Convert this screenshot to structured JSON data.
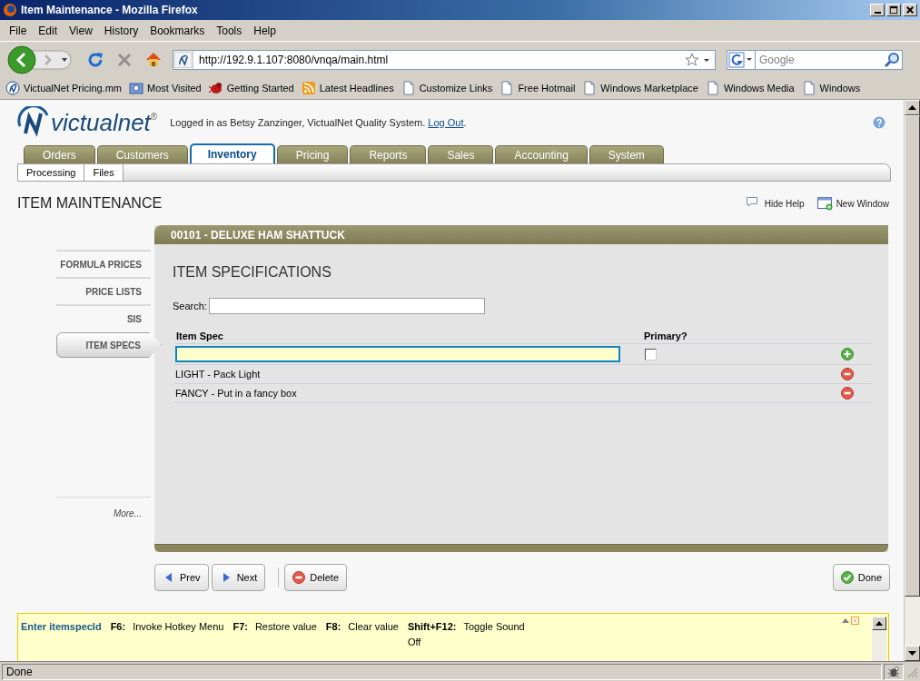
{
  "window": {
    "title": "Item Maintenance - Mozilla Firefox"
  },
  "menu": [
    "File",
    "Edit",
    "View",
    "History",
    "Bookmarks",
    "Tools",
    "Help"
  ],
  "address": {
    "value": "http://192.9.1.107:8080/vnqa/main.html"
  },
  "web_search": {
    "placeholder": "Google"
  },
  "bookmarks": [
    {
      "label": "VictualNet Pricing.mm",
      "kind": "site"
    },
    {
      "label": "Most Visited",
      "kind": "folder"
    },
    {
      "label": "Getting Started",
      "kind": "bug"
    },
    {
      "label": "Latest Headlines",
      "kind": "feed"
    },
    {
      "label": "Customize Links",
      "kind": "page"
    },
    {
      "label": "Free Hotmail",
      "kind": "page"
    },
    {
      "label": "Windows Marketplace",
      "kind": "page"
    },
    {
      "label": "Windows Media",
      "kind": "page"
    },
    {
      "label": "Windows",
      "kind": "page"
    }
  ],
  "header": {
    "logo": "victualnet",
    "logo_mark": "®",
    "login_text": "Logged in as Betsy Zanzinger, VictualNet Quality System.",
    "logout_link": "Log Out",
    "login_end": "."
  },
  "tabs": [
    {
      "label": "Orders",
      "selected": false
    },
    {
      "label": "Customers",
      "selected": false
    },
    {
      "label": "Inventory",
      "selected": true
    },
    {
      "label": "Pricing",
      "selected": false
    },
    {
      "label": "Reports",
      "selected": false
    },
    {
      "label": "Sales",
      "selected": false
    },
    {
      "label": "Accounting",
      "selected": false
    },
    {
      "label": "System",
      "selected": false
    }
  ],
  "subtabs": [
    "Processing",
    "Files"
  ],
  "page_title": "ITEM MAINTENANCE",
  "page_actions": [
    {
      "label": "Hide Help",
      "kind": "help"
    },
    {
      "label": "New Window",
      "kind": "window"
    }
  ],
  "side_nav": [
    {
      "label": "FORMULA PRICES",
      "selected": false
    },
    {
      "label": "PRICE LISTS",
      "selected": false
    },
    {
      "label": "SIS",
      "selected": false
    },
    {
      "label": "ITEM SPECS",
      "selected": true
    }
  ],
  "side_more": "More...",
  "panel": {
    "title": "00101 - DELUXE HAM SHATTUCK",
    "heading": "ITEM SPECIFICATIONS",
    "search_label": "Search:",
    "columns": [
      "Item Spec",
      "Primary?"
    ],
    "new_row": {
      "primary": {
        "checked": false
      }
    },
    "rows": [
      {
        "text": "LIGHT - Pack Light"
      },
      {
        "text": "FANCY - Put in a fancy box"
      }
    ]
  },
  "buttons": [
    {
      "label": "Prev",
      "kind": "prev"
    },
    {
      "label": "Next",
      "kind": "next"
    },
    {
      "label": "Delete",
      "kind": "delete"
    },
    {
      "label": "Done",
      "kind": "done"
    }
  ],
  "help_bar": {
    "title": "Enter itemspecId",
    "hotkeys": [
      {
        "key": "F6:",
        "action": "Invoke Hotkey Menu"
      },
      {
        "key": "F7:",
        "action": "Restore value"
      },
      {
        "key": "F8:",
        "action": "Clear value"
      },
      {
        "key": "Shift+F12:",
        "action": "Toggle Sound Off"
      }
    ]
  },
  "status_bar": {
    "text": "Done"
  }
}
